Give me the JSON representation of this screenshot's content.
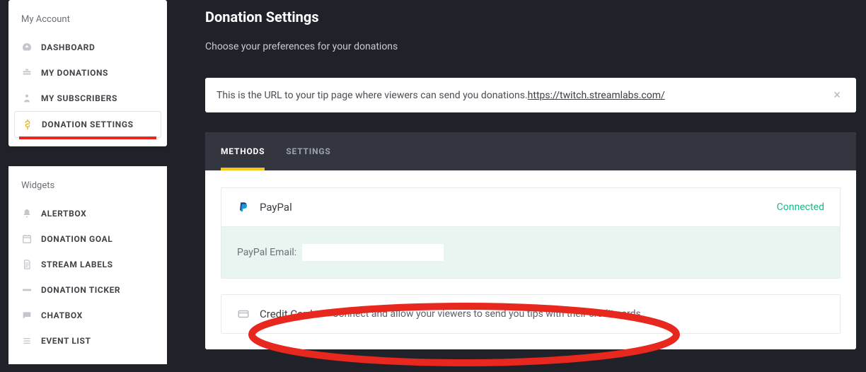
{
  "sidebar": {
    "account": {
      "title": "My Account",
      "items": [
        {
          "icon": "dashboard-icon",
          "label": "Dashboard"
        },
        {
          "icon": "donations-icon",
          "label": "My Donations"
        },
        {
          "icon": "subscribers-icon",
          "label": "My Subscribers"
        },
        {
          "icon": "dollar-icon",
          "label": "Donation Settings",
          "active": true
        }
      ]
    },
    "widgets": {
      "title": "Widgets",
      "items": [
        {
          "icon": "bell-icon",
          "label": "Alertbox"
        },
        {
          "icon": "calendar-icon",
          "label": "Donation Goal"
        },
        {
          "icon": "file-icon",
          "label": "Stream Labels"
        },
        {
          "icon": "ticker-icon",
          "label": "Donation Ticker"
        },
        {
          "icon": "chat-icon",
          "label": "Chatbox"
        },
        {
          "icon": "list-icon",
          "label": "Event List"
        }
      ]
    }
  },
  "page": {
    "title": "Donation Settings",
    "subtitle": "Choose your preferences for your donations"
  },
  "alert": {
    "text": "This is the URL to your tip page where viewers can send you donations. ",
    "link": "https://twitch.streamlabs.com/"
  },
  "tabs": {
    "methods": "Methods",
    "settings": "Settings"
  },
  "methods": {
    "paypal": {
      "title": "PayPal",
      "status": "Connected",
      "email_label": "PayPal Email:",
      "email_value": ""
    },
    "credit": {
      "title": "Credit Cards",
      "desc": "Connect and allow your viewers to send you tips with their credit cards."
    }
  },
  "colors": {
    "accent_red": "#e8271e",
    "accent_yellow": "#f5c518",
    "status_connected": "#19b88a"
  }
}
